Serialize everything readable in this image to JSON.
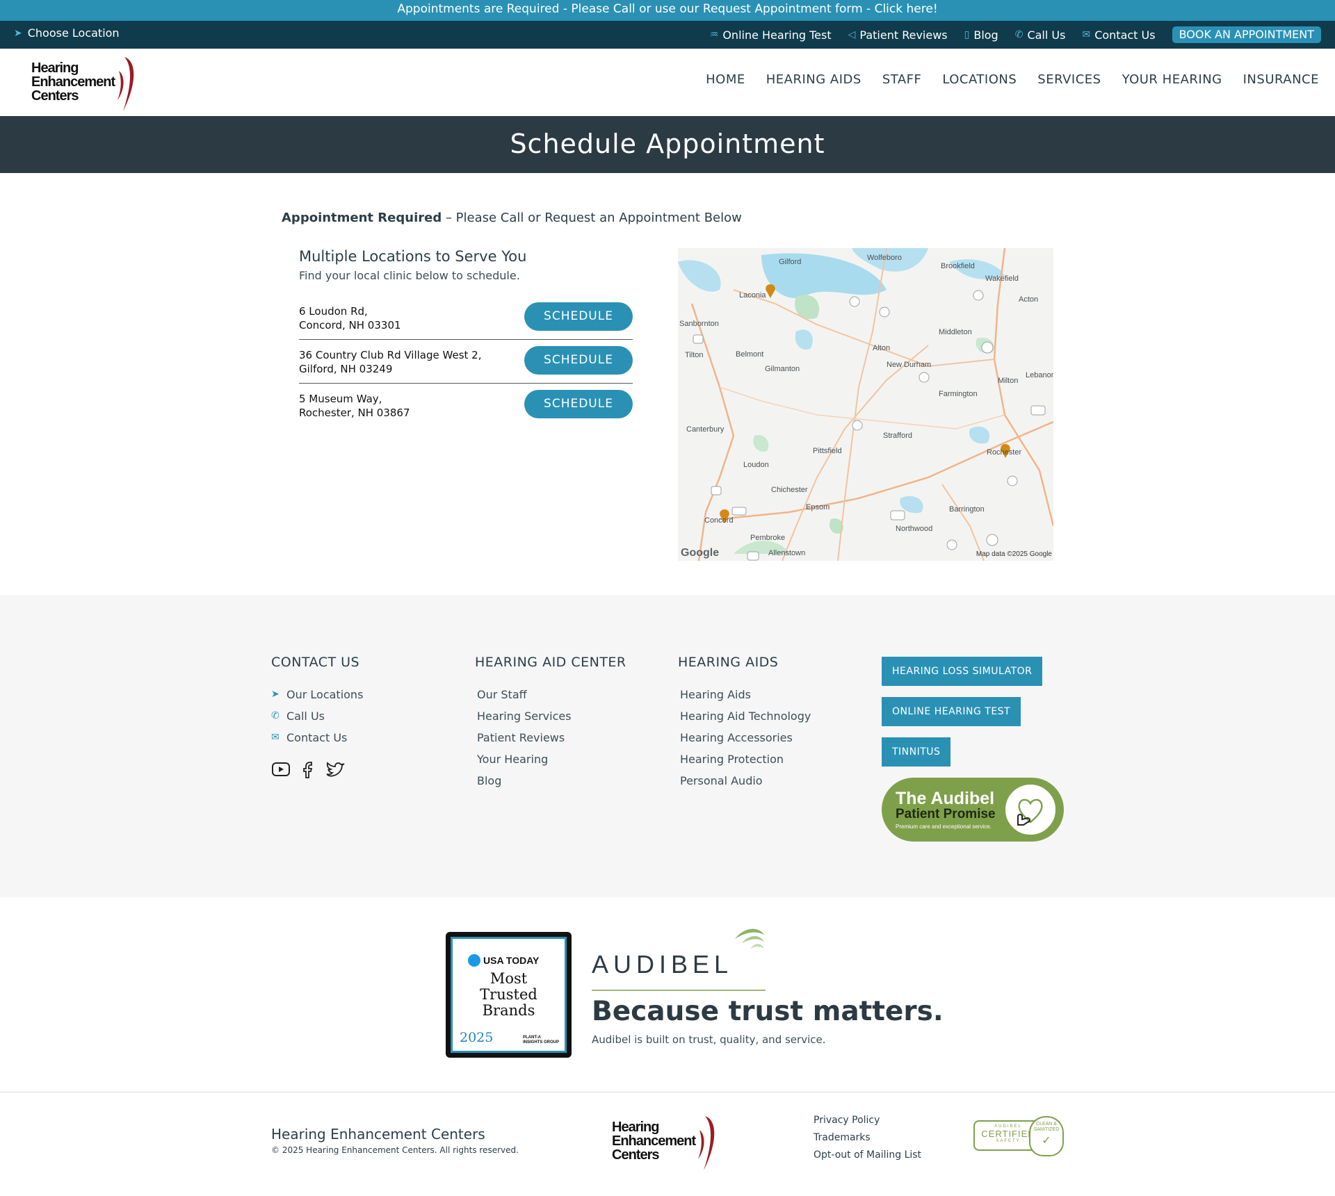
{
  "announcement": "Appointments are Required - Please Call or use our Request Appointment form - Click here!",
  "utility": {
    "choose_location": "Choose Location",
    "links": [
      {
        "label": "Online Hearing Test",
        "icon": "ear-icon"
      },
      {
        "label": "Patient Reviews",
        "icon": "megaphone-icon"
      },
      {
        "label": "Blog",
        "icon": "document-icon"
      },
      {
        "label": "Call Us",
        "icon": "phone-icon"
      },
      {
        "label": "Contact Us",
        "icon": "envelope-icon"
      }
    ],
    "book_label": "BOOK AN APPOINTMENT"
  },
  "logo": {
    "line1": "Hearing",
    "line2": "Enhancement",
    "line3": "Centers"
  },
  "nav": [
    "HOME",
    "HEARING AIDS",
    "STAFF",
    "LOCATIONS",
    "SERVICES",
    "YOUR HEARING",
    "INSURANCE"
  ],
  "page_title": "Schedule Appointment",
  "intro": {
    "bold": "Appointment Required",
    "rest": " – Please Call or Request an Appointment Below"
  },
  "locations_section": {
    "heading": "Multiple Locations to Serve You",
    "subheading": "Find your local clinic below to schedule.",
    "schedule_label": "SCHEDULE",
    "locations": [
      {
        "line1": "6 Loudon Rd,",
        "line2": "Concord, NH 03301"
      },
      {
        "line1": "36 Country Club Rd Village West 2,",
        "line2": "Gilford, NH 03249"
      },
      {
        "line1": "5 Museum Way,",
        "line2": "Rochester, NH 03867"
      }
    ]
  },
  "map": {
    "towns": [
      "Gilford",
      "Wolfeboro",
      "Brookfield",
      "Wakefield",
      "Acton",
      "Laconia",
      "Sanbornton",
      "Middleton",
      "Tilton",
      "Belmont",
      "Alton",
      "Gilmanton",
      "New Durham",
      "Milton",
      "Lebanon",
      "Farmington",
      "Canterbury",
      "Strafford",
      "Pittsfield",
      "Rochester",
      "Loudon",
      "Chichester",
      "Epsom",
      "Barrington",
      "Concord",
      "Northwood",
      "Pembroke",
      "Allenstown"
    ],
    "routes": [
      "11",
      "28",
      "16",
      "125",
      "93",
      "11",
      "202",
      "28",
      "93",
      "393",
      "202",
      "9",
      "4",
      "125",
      "3"
    ],
    "attribution": "Map data ©2025 Google",
    "brand": "Google",
    "pin_color": "#d48a12"
  },
  "footer": {
    "contact": {
      "heading": "CONTACT US",
      "items": [
        {
          "label": "Our Locations",
          "icon": "location-arrow-icon"
        },
        {
          "label": "Call Us",
          "icon": "phone-icon"
        },
        {
          "label": "Contact Us",
          "icon": "envelope-icon"
        }
      ]
    },
    "center": {
      "heading": "HEARING AID CENTER",
      "items": [
        "Our Staff",
        "Hearing Services",
        "Patient Reviews",
        "Your Hearing",
        "Blog"
      ]
    },
    "aids": {
      "heading": "HEARING AIDS",
      "items": [
        "Hearing Aids",
        "Hearing Aid Technology",
        "Hearing Accessories",
        "Hearing Protection",
        "Personal Audio"
      ]
    },
    "buttons": [
      "HEARING LOSS SIMULATOR",
      "ONLINE HEARING TEST",
      "TINNITUS"
    ],
    "promise": {
      "title": "The Audibel",
      "subtitle": "Patient Promise",
      "tagline": "Premium care and exceptional service."
    }
  },
  "trust": {
    "badge": {
      "brand": "USA TODAY",
      "line1": "Most",
      "line2": "Trusted",
      "line3": "Brands",
      "year": "2025",
      "partner1": "PLANT-A",
      "partner2": "INSIGHTS GROUP"
    },
    "audibel_logo": "AUDIBEL",
    "headline": "Because trust matters.",
    "sub": "Audibel is built on trust, quality, and service."
  },
  "bottom": {
    "company": "Hearing Enhancement Centers",
    "copyright": "© 2025 Hearing Enhancement Centers. All rights reserved.",
    "links": [
      "Privacy Policy",
      "Trademarks",
      "Opt-out of Mailing List"
    ],
    "certified": {
      "top": "AUDIBEL",
      "main": "CERTIFIED",
      "bottom": "SAFETY",
      "seal1": "CLEAN &",
      "seal2": "SANITIZED"
    }
  },
  "colors": {
    "primary": "#2a91b5",
    "dark": "#0f3b4c",
    "title_band": "#2c3a43",
    "footer_bg": "#f6f6f6",
    "promise_green": "#7fa04a",
    "logo_red": "#9b1c22"
  }
}
